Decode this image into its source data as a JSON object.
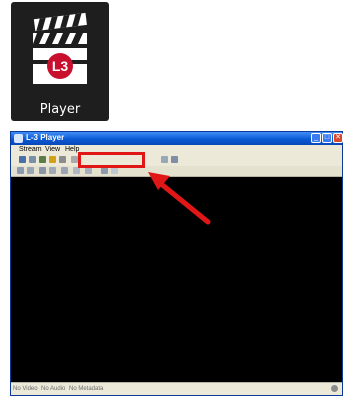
{
  "app_icon": {
    "label": "Player",
    "badge": "L3",
    "icon": "clapperboard-icon"
  },
  "window": {
    "title": "L-3 Player",
    "controls": {
      "minimize": "_",
      "maximize": "□",
      "close": "✕"
    }
  },
  "menu": [
    "Stream",
    "View",
    "Help"
  ],
  "status": {
    "left": "No Video",
    "middle": "No Audio",
    "right": "No Metadata"
  },
  "colors": {
    "accent_red": "#e11717",
    "title_blue": "#0a5ad6",
    "combo_fill": "#2f5fbf"
  }
}
